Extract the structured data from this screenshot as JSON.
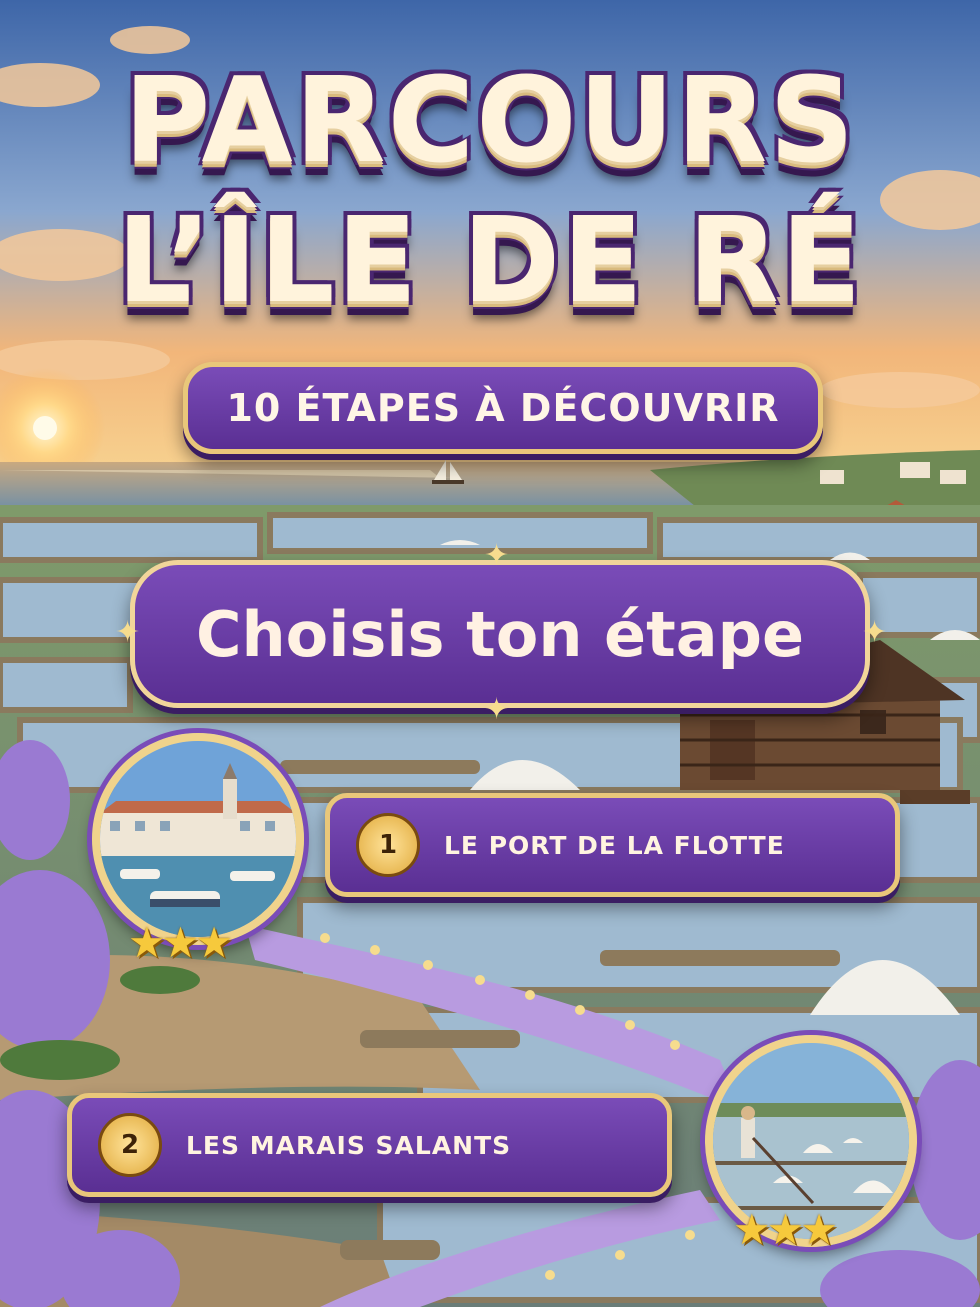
{
  "game": {
    "title_line1": "PARCOURS",
    "title_line2": "L’ÎLE DE RÉ",
    "subtitle": "10 ÉTAPES À DÉCOUVRIR",
    "prompt": "Choisis ton étape"
  },
  "stages": [
    {
      "number": "1",
      "label": "LE PORT DE LA FLOTTE",
      "stars": "★★★",
      "stars_earned": 3
    },
    {
      "number": "2",
      "label": "LES MARAIS SALANTS",
      "stars": "★★★",
      "stars_earned": 3
    }
  ],
  "colors": {
    "accent_purple": "#6a3fa8",
    "gold_border": "#e9c77a",
    "star_gold": "#f6c93c",
    "path_lavender": "#b89be0"
  }
}
